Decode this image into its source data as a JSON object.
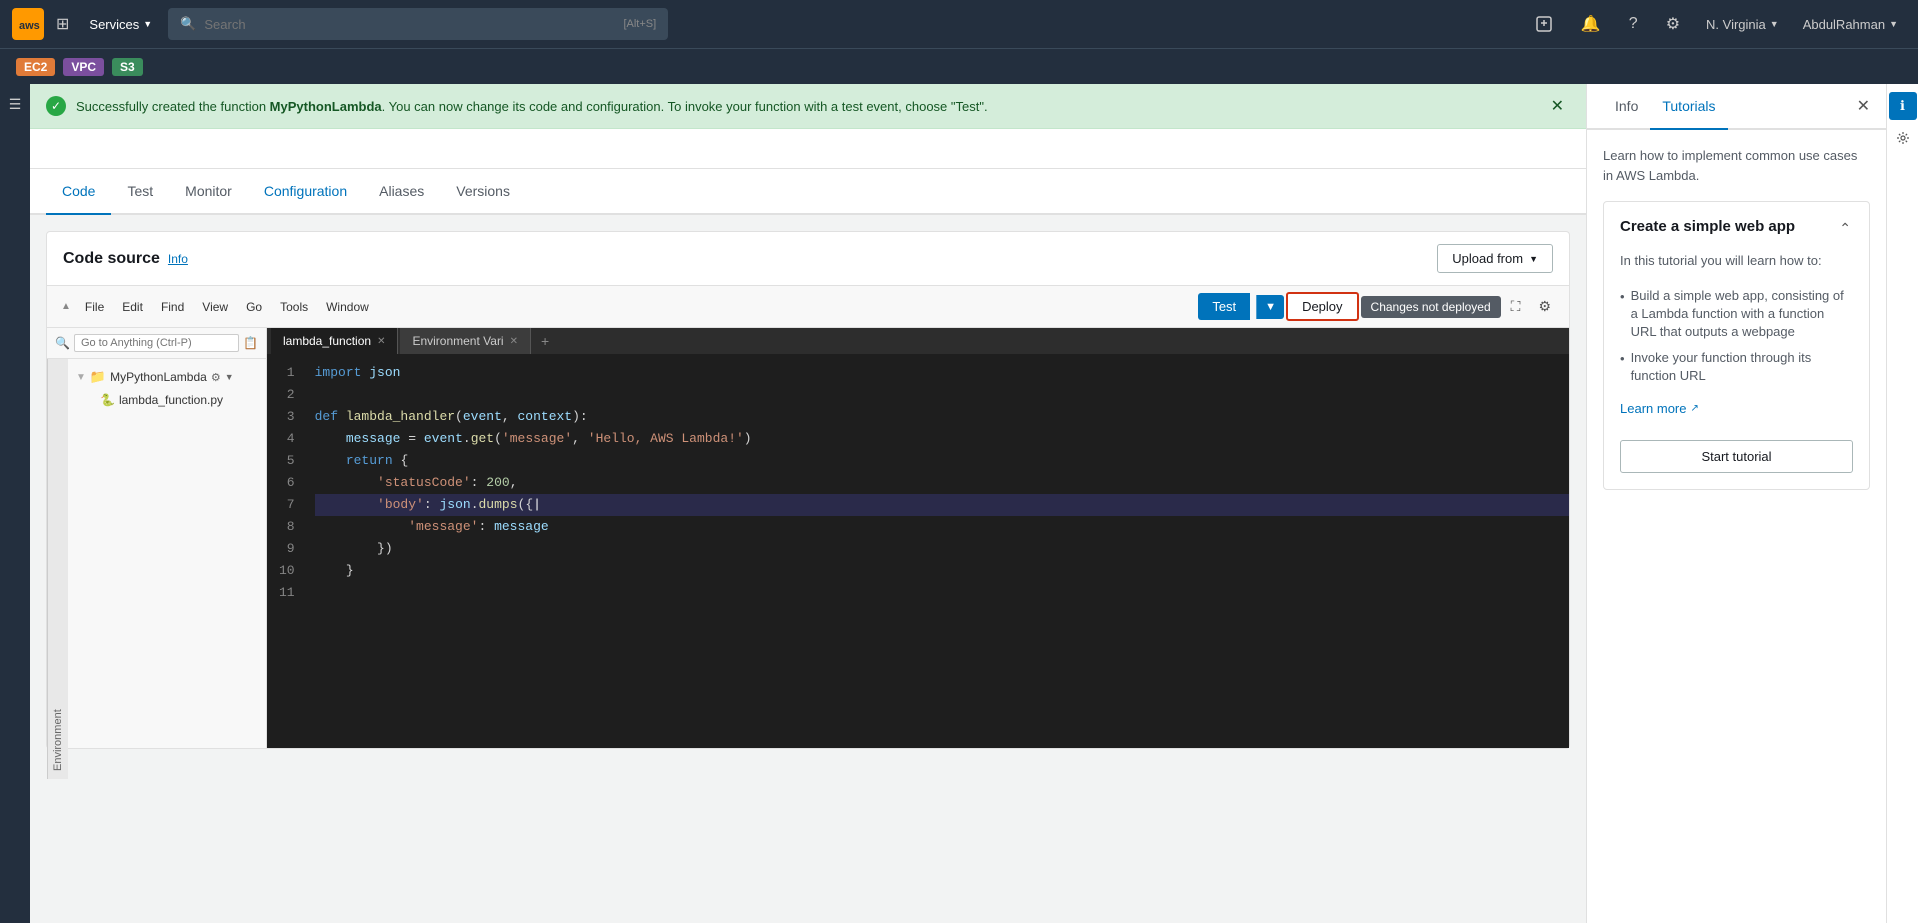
{
  "topNav": {
    "awsLogoText": "aws",
    "servicesLabel": "Services",
    "searchPlaceholder": "Search",
    "searchShortcut": "[Alt+S]",
    "regionLabel": "N. Virginia",
    "userLabel": "AbdulRahman"
  },
  "serviceTags": [
    {
      "id": "ec2",
      "label": "EC2",
      "color": "#e07b39"
    },
    {
      "id": "vpc",
      "label": "VPC",
      "color": "#7b4f9e"
    },
    {
      "id": "s3",
      "label": "S3",
      "color": "#3a8c5c"
    }
  ],
  "successBanner": {
    "text1": "Successfully created the function ",
    "functionName": "MyPythonLambda",
    "text2": ". You can now change its code and configuration. To invoke your function with a test event, choose \"Test\"."
  },
  "tabs": [
    {
      "id": "code",
      "label": "Code",
      "active": true
    },
    {
      "id": "test",
      "label": "Test",
      "active": false
    },
    {
      "id": "monitor",
      "label": "Monitor",
      "active": false
    },
    {
      "id": "configuration",
      "label": "Configuration",
      "active": false
    },
    {
      "id": "aliases",
      "label": "Aliases",
      "active": false
    },
    {
      "id": "versions",
      "label": "Versions",
      "active": false
    }
  ],
  "codeSource": {
    "title": "Code source",
    "infoLabel": "Info",
    "uploadFromLabel": "Upload from",
    "toolbarMenuItems": [
      "File",
      "Edit",
      "Find",
      "View",
      "Go",
      "Tools",
      "Window"
    ],
    "testLabel": "Test",
    "deployLabel": "Deploy",
    "changesNotDeployedLabel": "Changes not deployed",
    "fileExplorer": {
      "searchPlaceholder": "Go to Anything (Ctrl-P)",
      "envLabel": "Environment",
      "folderName": "MyPythonLambda",
      "fileName": "lambda_function.py"
    },
    "editorTabs": [
      {
        "label": "lambda_function",
        "active": true
      },
      {
        "label": "Environment Vari",
        "active": false
      }
    ],
    "codeLines": [
      {
        "num": 1,
        "code": "import json"
      },
      {
        "num": 2,
        "code": ""
      },
      {
        "num": 3,
        "code": "def lambda_handler(event, context):"
      },
      {
        "num": 4,
        "code": "    message = event.get('message', 'Hello, AWS Lambda!')"
      },
      {
        "num": 5,
        "code": "    return {"
      },
      {
        "num": 6,
        "code": "        'statusCode': 200,"
      },
      {
        "num": 7,
        "code": "        'body': json.dumps({",
        "highlighted": true
      },
      {
        "num": 8,
        "code": "            'message': message"
      },
      {
        "num": 9,
        "code": "        })"
      },
      {
        "num": 10,
        "code": "    }"
      },
      {
        "num": 11,
        "code": ""
      }
    ]
  },
  "rightPanel": {
    "infoTabLabel": "Info",
    "tutorialsTabLabel": "Tutorials",
    "activeTab": "Tutorials",
    "description": "Learn how to implement common use cases in AWS Lambda.",
    "tutorialCard": {
      "title": "Create a simple web app",
      "body": "In this tutorial you will learn how to:",
      "listItems": [
        "Build a simple web app, consisting of a Lambda function with a function URL that outputs a webpage",
        "Invoke your function through its function URL"
      ],
      "learnMoreLabel": "Learn more",
      "startTutorialLabel": "Start tutorial"
    }
  }
}
